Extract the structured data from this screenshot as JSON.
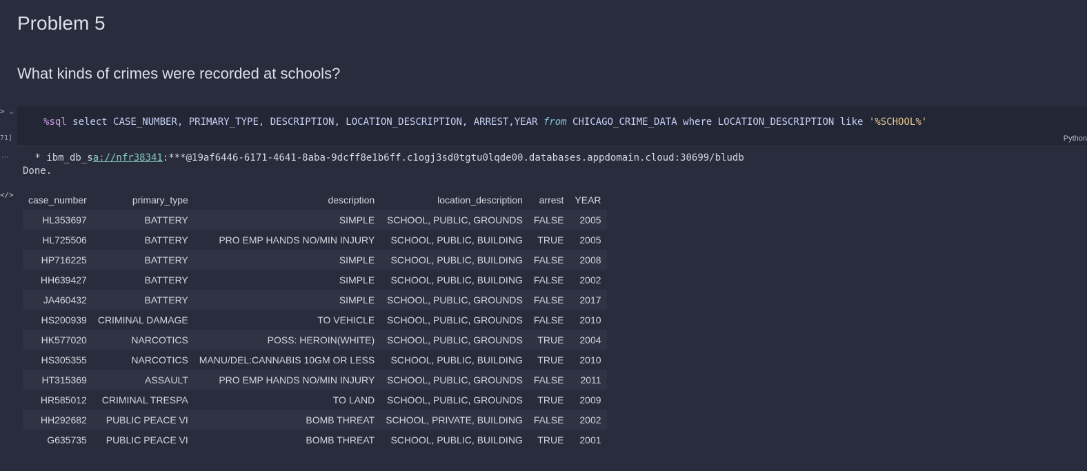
{
  "markdown": {
    "heading": "Problem 5",
    "question": "What kinds of crimes were recorded at schools?"
  },
  "gutter": {
    "run_glyph": "> ⌵",
    "exec_count": "71]",
    "more_glyph": "···",
    "output_glyph": "</>"
  },
  "code_cell": {
    "magic": "%sql",
    "part1": " select CASE_NUMBER, PRIMARY_TYPE, DESCRIPTION, LOCATION_DESCRIPTION, ARREST,YEAR ",
    "from_kw": "from",
    "part2": " CHICAGO_CRIME_DATA where LOCATION_DESCRIPTION like ",
    "pattern": "'%SCHOOL%'",
    "language": "Python"
  },
  "output": {
    "conn_prefix": " * ibm_db_s",
    "conn_link": "a://nfr38341",
    "conn_suffix": ":***@19af6446-6171-4641-8aba-9dcff8e1b6ff.c1ogj3sd0tgtu0lqde00.databases.appdomain.cloud:30699/bludb",
    "status": "Done."
  },
  "table": {
    "headers": [
      "case_number",
      "primary_type",
      "description",
      "location_description",
      "arrest",
      "YEAR"
    ],
    "rows": [
      [
        "HL353697",
        "BATTERY",
        "SIMPLE",
        "SCHOOL, PUBLIC, GROUNDS",
        "FALSE",
        "2005"
      ],
      [
        "HL725506",
        "BATTERY",
        "PRO EMP HANDS NO/MIN INJURY",
        "SCHOOL, PUBLIC, BUILDING",
        "TRUE",
        "2005"
      ],
      [
        "HP716225",
        "BATTERY",
        "SIMPLE",
        "SCHOOL, PUBLIC, BUILDING",
        "FALSE",
        "2008"
      ],
      [
        "HH639427",
        "BATTERY",
        "SIMPLE",
        "SCHOOL, PUBLIC, BUILDING",
        "FALSE",
        "2002"
      ],
      [
        "JA460432",
        "BATTERY",
        "SIMPLE",
        "SCHOOL, PUBLIC, GROUNDS",
        "FALSE",
        "2017"
      ],
      [
        "HS200939",
        "CRIMINAL DAMAGE",
        "TO VEHICLE",
        "SCHOOL, PUBLIC, GROUNDS",
        "FALSE",
        "2010"
      ],
      [
        "HK577020",
        "NARCOTICS",
        "POSS: HEROIN(WHITE)",
        "SCHOOL, PUBLIC, GROUNDS",
        "TRUE",
        "2004"
      ],
      [
        "HS305355",
        "NARCOTICS",
        "MANU/DEL:CANNABIS 10GM OR LESS",
        "SCHOOL, PUBLIC, BUILDING",
        "TRUE",
        "2010"
      ],
      [
        "HT315369",
        "ASSAULT",
        "PRO EMP HANDS NO/MIN INJURY",
        "SCHOOL, PUBLIC, GROUNDS",
        "FALSE",
        "2011"
      ],
      [
        "HR585012",
        "CRIMINAL TRESPA",
        "TO LAND",
        "SCHOOL, PUBLIC, GROUNDS",
        "TRUE",
        "2009"
      ],
      [
        "HH292682",
        "PUBLIC PEACE VI",
        "BOMB THREAT",
        "SCHOOL, PRIVATE, BUILDING",
        "FALSE",
        "2002"
      ],
      [
        "G635735",
        "PUBLIC PEACE VI",
        "BOMB THREAT",
        "SCHOOL, PUBLIC, BUILDING",
        "TRUE",
        "2001"
      ]
    ]
  }
}
